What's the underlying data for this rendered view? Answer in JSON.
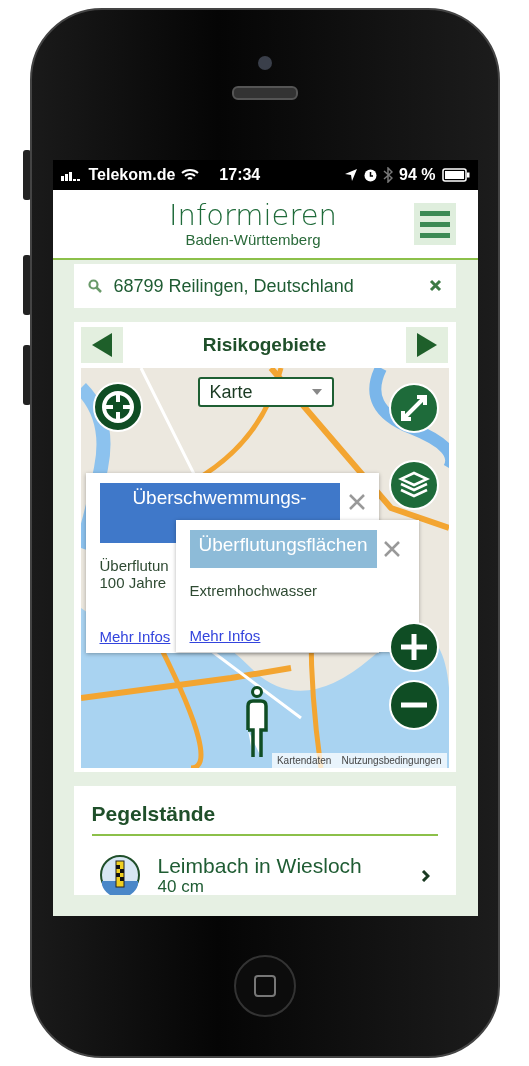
{
  "status_bar": {
    "carrier": "Telekom.de",
    "time": "17:34",
    "battery": "94 %"
  },
  "header": {
    "title": "Informieren",
    "subtitle": "Baden-Württemberg"
  },
  "search": {
    "value": "68799 Reilingen, Deutschland"
  },
  "risk_panel": {
    "title": "Risikogebiete",
    "map_type": "Karte",
    "popups": [
      {
        "title": "Überschwemmungs-",
        "color": "#3f78c9",
        "lines": [
          "Überflutun",
          "100 Jahre"
        ],
        "link": "Mehr Infos"
      },
      {
        "title": "Überflutungsflächen",
        "color": "#8dbbd8",
        "lines": [
          "Extremhochwasser"
        ],
        "link": "Mehr Infos"
      }
    ],
    "map_footer": [
      "Kartendaten",
      "Nutzungsbedingungen"
    ]
  },
  "gauges": {
    "title": "Pegelstände",
    "items": [
      {
        "name": "Leimbach in Wiesloch",
        "reading": "40 cm"
      }
    ]
  }
}
